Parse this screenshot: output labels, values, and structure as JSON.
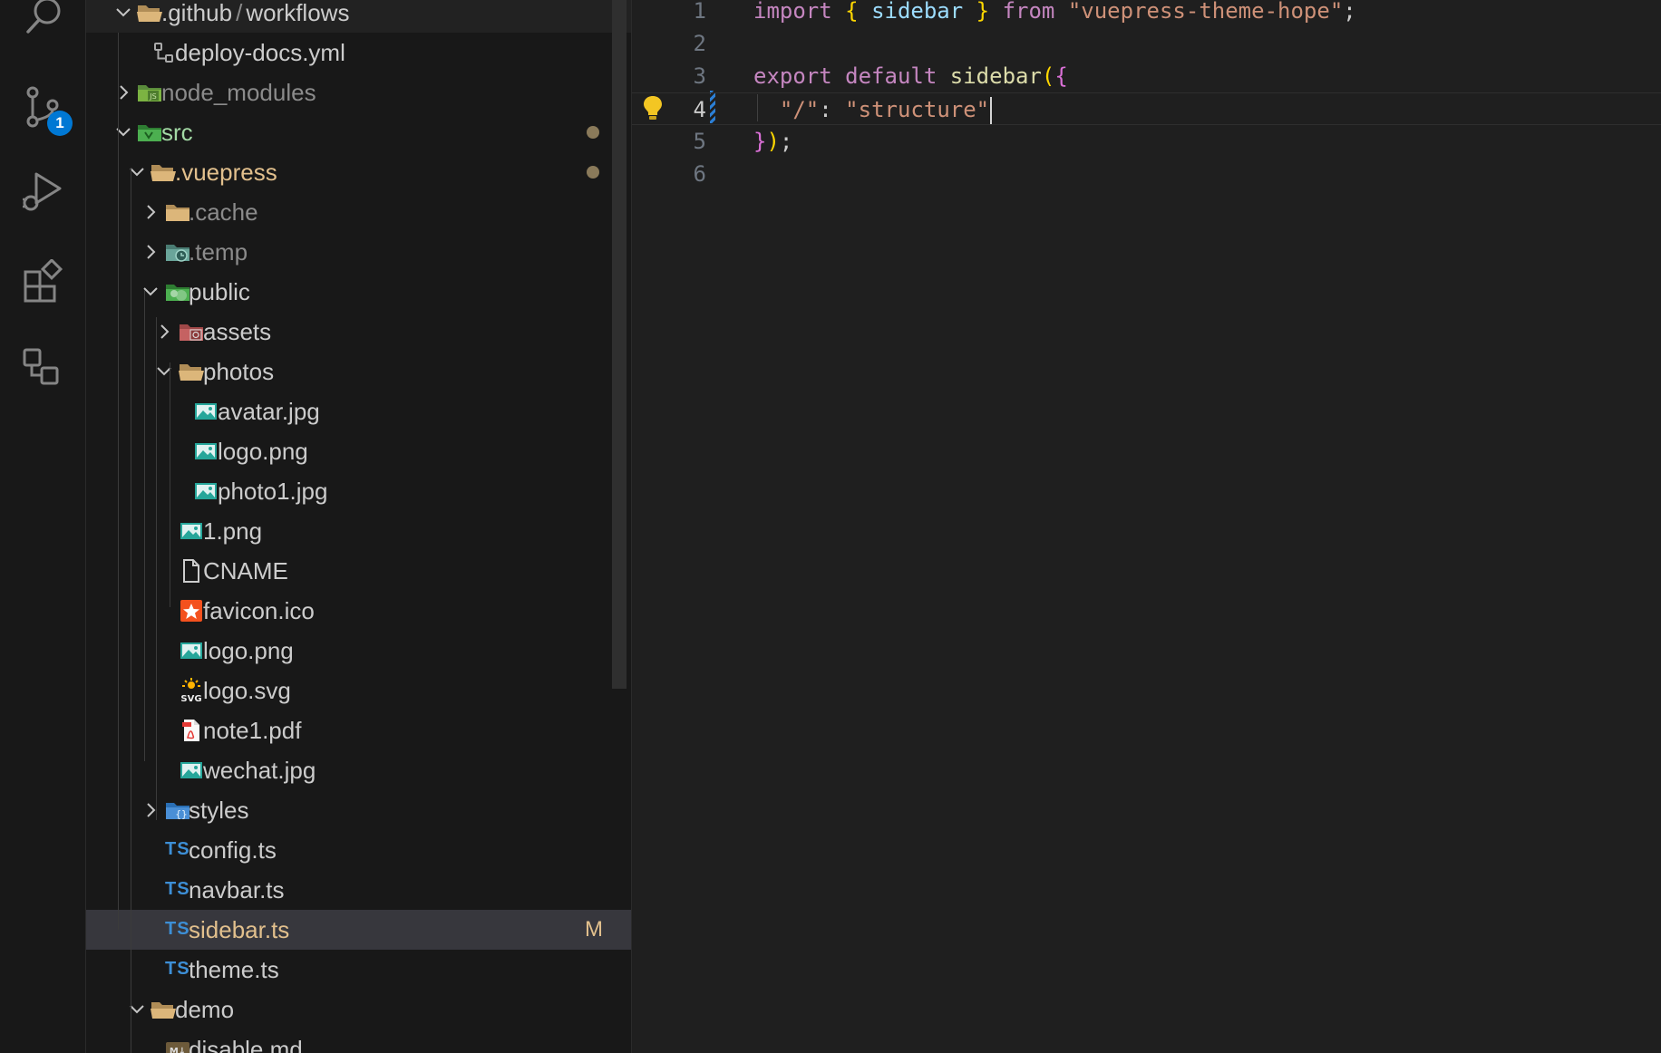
{
  "activity_bar": {
    "items": [
      {
        "name": "search-icon"
      },
      {
        "name": "source-control-icon",
        "badge": "1"
      },
      {
        "name": "run-debug-icon"
      },
      {
        "name": "extensions-icon"
      },
      {
        "name": "remote-explorer-icon"
      }
    ]
  },
  "explorer": {
    "tree": [
      {
        "label": ".github",
        "label2": "workflows",
        "separator": "/",
        "type": "folder-open",
        "expanded": true,
        "header": true
      },
      {
        "label": "deploy-docs.yml",
        "type": "workflow-file"
      },
      {
        "label": "node_modules",
        "type": "node-folder",
        "expanded": false,
        "dimmed": true
      },
      {
        "label": "src",
        "type": "src-folder",
        "expanded": true,
        "modified_dot": true
      },
      {
        "label": ".vuepress",
        "type": "folder-open",
        "expanded": true,
        "modified_dot": true,
        "modified": true
      },
      {
        "label": ".cache",
        "type": "folder",
        "expanded": false,
        "dimmed": true
      },
      {
        "label": ".temp",
        "type": "temp-folder",
        "expanded": false,
        "dimmed": true
      },
      {
        "label": "public",
        "type": "public-folder",
        "expanded": true
      },
      {
        "label": "assets",
        "type": "assets-folder",
        "expanded": false
      },
      {
        "label": "photos",
        "type": "folder-open",
        "expanded": true
      },
      {
        "label": "avatar.jpg",
        "type": "image-file"
      },
      {
        "label": "logo.png",
        "type": "image-file"
      },
      {
        "label": "photo1.jpg",
        "type": "image-file"
      },
      {
        "label": "1.png",
        "type": "image-file"
      },
      {
        "label": "CNAME",
        "type": "plain-file"
      },
      {
        "label": "favicon.ico",
        "type": "favicon-file"
      },
      {
        "label": "logo.png",
        "type": "image-file"
      },
      {
        "label": "logo.svg",
        "type": "svg-file"
      },
      {
        "label": "note1.pdf",
        "type": "pdf-file"
      },
      {
        "label": "wechat.jpg",
        "type": "image-file"
      },
      {
        "label": "styles",
        "type": "styles-folder",
        "expanded": false
      },
      {
        "label": "config.ts",
        "type": "ts-file",
        "icon_text": "TS"
      },
      {
        "label": "navbar.ts",
        "type": "ts-file",
        "icon_text": "TS"
      },
      {
        "label": "sidebar.ts",
        "type": "ts-file",
        "icon_text": "TS",
        "selected": true,
        "modified": true,
        "status": "M"
      },
      {
        "label": "theme.ts",
        "type": "ts-file",
        "icon_text": "TS"
      },
      {
        "label": "demo",
        "type": "folder-open",
        "expanded": true
      },
      {
        "label": "disable.md",
        "type": "md-file"
      }
    ]
  },
  "editor": {
    "active_line": 4,
    "lines": [
      {
        "num": "1",
        "tokens": [
          {
            "t": "import",
            "c": "kw"
          },
          {
            "t": " ",
            "c": "punc"
          },
          {
            "t": "{",
            "c": "b1"
          },
          {
            "t": " ",
            "c": "punc"
          },
          {
            "t": "sidebar",
            "c": "id"
          },
          {
            "t": " ",
            "c": "punc"
          },
          {
            "t": "}",
            "c": "b1"
          },
          {
            "t": " ",
            "c": "punc"
          },
          {
            "t": "from",
            "c": "kw"
          },
          {
            "t": " ",
            "c": "punc"
          },
          {
            "t": "\"vuepress-theme-hope\"",
            "c": "str"
          },
          {
            "t": ";",
            "c": "punc"
          }
        ]
      },
      {
        "num": "2",
        "tokens": []
      },
      {
        "num": "3",
        "tokens": [
          {
            "t": "export",
            "c": "kw"
          },
          {
            "t": " ",
            "c": "punc"
          },
          {
            "t": "default",
            "c": "kw"
          },
          {
            "t": " ",
            "c": "punc"
          },
          {
            "t": "sidebar",
            "c": "fn"
          },
          {
            "t": "(",
            "c": "b1"
          },
          {
            "t": "{",
            "c": "b2"
          }
        ]
      },
      {
        "num": "4",
        "tokens": [
          {
            "t": "  ",
            "c": "punc"
          },
          {
            "t": "\"/\"",
            "c": "str"
          },
          {
            "t": ": ",
            "c": "punc"
          },
          {
            "t": "\"structure\"",
            "c": "str"
          }
        ],
        "cursor": true
      },
      {
        "num": "5",
        "tokens": [
          {
            "t": "}",
            "c": "b2"
          },
          {
            "t": ")",
            "c": "b1"
          },
          {
            "t": ";",
            "c": "punc"
          }
        ]
      },
      {
        "num": "6",
        "tokens": []
      }
    ]
  },
  "colors": {
    "accent": "#0078d4",
    "modified": "#e2c08d",
    "ts_icon": "#3d8fd6",
    "keyword": "#c586c0",
    "string": "#ce9178"
  }
}
